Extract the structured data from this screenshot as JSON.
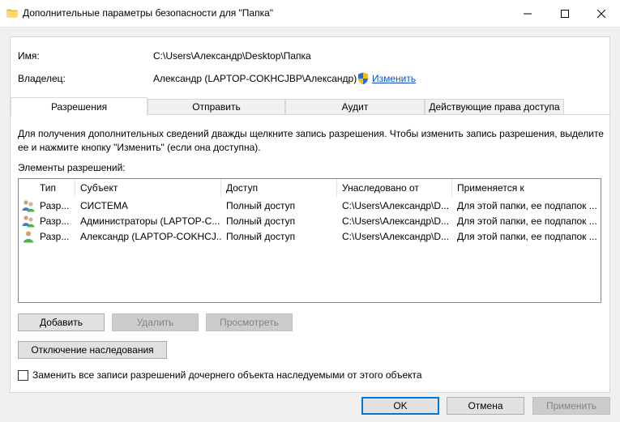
{
  "window": {
    "title": "Дополнительные параметры безопасности  для \"Папка\""
  },
  "fields": {
    "name_label": "Имя:",
    "name_value": "C:\\Users\\Александр\\Desktop\\Папка",
    "owner_label": "Владелец:",
    "owner_value": "Александр (LAPTOP-COKHCJBP\\Александр)",
    "change_link": "Изменить"
  },
  "tabs": [
    {
      "label": "Разрешения",
      "active": true
    },
    {
      "label": "Отправить",
      "active": false
    },
    {
      "label": "Аудит",
      "active": false
    },
    {
      "label": "Действующие права доступа",
      "active": false
    }
  ],
  "hint": "Для получения дополнительных сведений дважды щелкните запись разрешения. Чтобы изменить запись разрешения, выделите ее и нажмите кнопку \"Изменить\" (если она доступна).",
  "permissions": {
    "label": "Элементы разрешений:",
    "columns": [
      "Тип",
      "Субъект",
      "Доступ",
      "Унаследовано от",
      "Применяется к"
    ],
    "rows": [
      {
        "icon": "group-users-icon",
        "type": "Разр...",
        "subject": "СИСТЕМА",
        "access": "Полный доступ",
        "inherited": "C:\\Users\\Александр\\D...",
        "applies": "Для этой папки, ее подпапок ..."
      },
      {
        "icon": "group-users-icon",
        "type": "Разр...",
        "subject": "Администраторы (LAPTOP-C...",
        "access": "Полный доступ",
        "inherited": "C:\\Users\\Александр\\D...",
        "applies": "Для этой папки, ее подпапок ..."
      },
      {
        "icon": "user-icon",
        "type": "Разр...",
        "subject": "Александр (LAPTOP-COKHCJ...",
        "access": "Полный доступ",
        "inherited": "C:\\Users\\Александр\\D...",
        "applies": "Для этой папки, ее подпапок ..."
      }
    ]
  },
  "buttons": {
    "add": "Добавить",
    "remove": "Удалить",
    "view": "Просмотреть",
    "disable_inheritance": "Отключение наследования",
    "ok": "OK",
    "cancel": "Отмена",
    "apply": "Применить"
  },
  "replace_checkbox": {
    "label": "Заменить все записи разрешений дочернего объекта наследуемыми от этого объекта",
    "checked": false
  },
  "colors": {
    "accent": "#0078d7",
    "link": "#0b55c5"
  }
}
